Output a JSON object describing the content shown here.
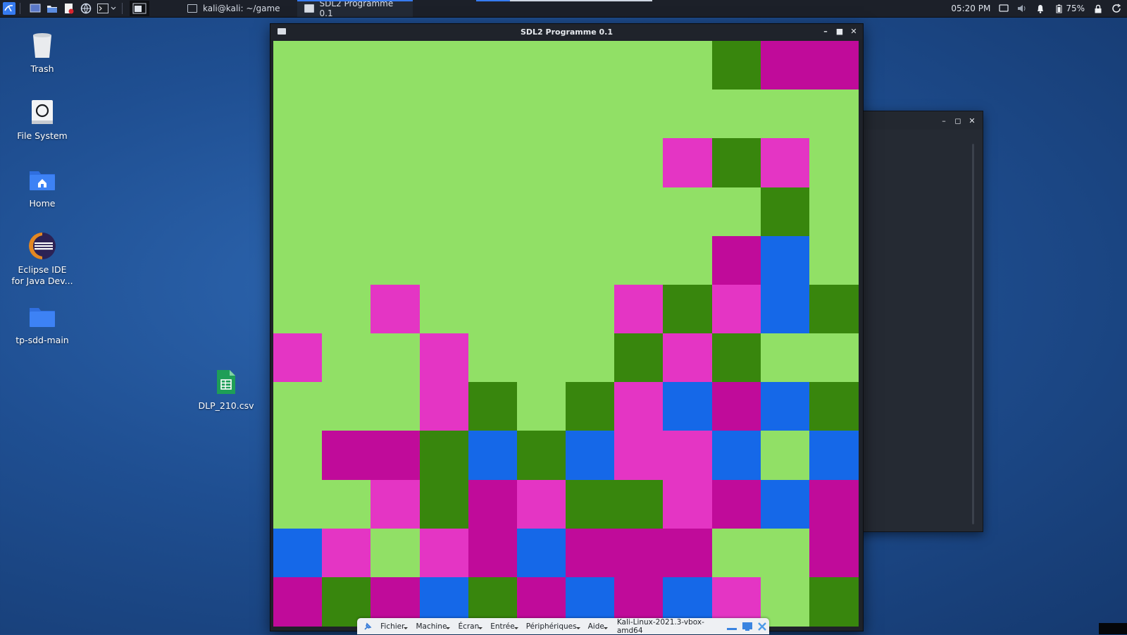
{
  "taskbar": {
    "tasks": [
      {
        "label": "kali@kali: ~/game",
        "active": false
      },
      {
        "label": "SDL2 Programme 0.1",
        "active": true
      }
    ],
    "clock": "05:20 PM",
    "battery": "75%"
  },
  "desktop": {
    "items": [
      {
        "label": "Trash",
        "icon": "trash-icon"
      },
      {
        "label": "File System",
        "icon": "drive-icon"
      },
      {
        "label": "Home",
        "icon": "home-folder-icon"
      },
      {
        "label": "Eclipse IDE\nfor Java Dev...",
        "icon": "eclipse-icon"
      },
      {
        "label": "tp-sdd-main",
        "icon": "folder-icon"
      },
      {
        "label": "DLP_210.csv",
        "icon": "spreadsheet-icon"
      }
    ]
  },
  "window": {
    "title": "SDL2 Programme 0.1"
  },
  "game": {
    "palette": {
      "L": "#91e066",
      "D": "#38860d",
      "M": "#c00b9a",
      "P": "#e435c4",
      "B": "#1568e8"
    },
    "grid": [
      "LLLLLLLLLDMM",
      "LLLLLLLLLLLL",
      "LLLLLLLLPDPL",
      "LLLLLLLLLLDL",
      "LLLLLLLLLMBL",
      "LLPLLLLPDPBD",
      "PLLPLLLDPDLL",
      "LLLPDLDPBMBD",
      "LMMDBDBPPBLB",
      "LLPDMPDDPMBM",
      "BPLPMBMMMLLM",
      "MDMBDMBMBPLD"
    ]
  },
  "vbox": {
    "menus": [
      "Fichier",
      "Machine",
      "Écran",
      "Entrée",
      "Périphériques",
      "Aide"
    ],
    "machine": "Kali-Linux-2021.3-vbox-amd64"
  }
}
